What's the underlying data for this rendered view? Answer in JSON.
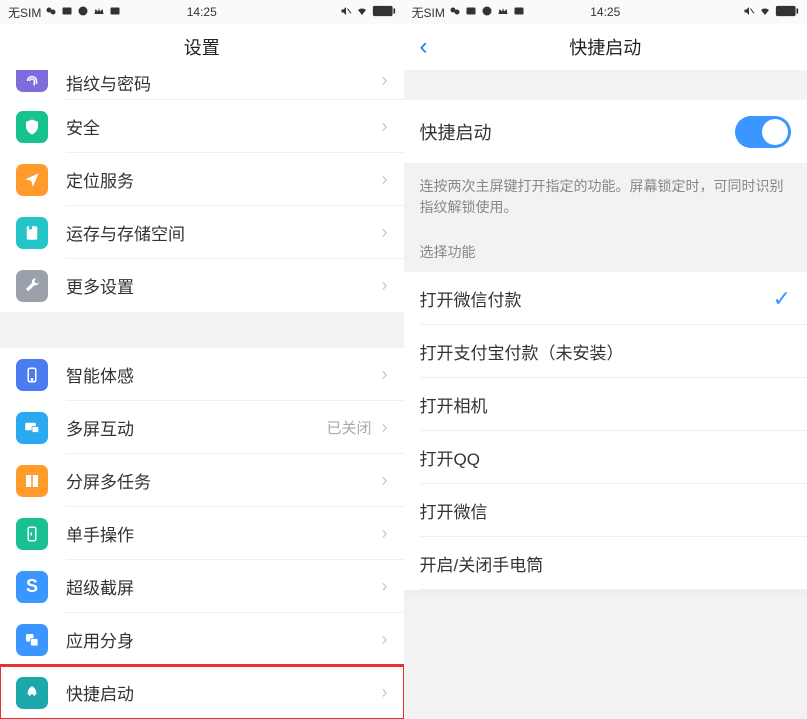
{
  "status": {
    "nosim": "无SIM",
    "time": "14:25"
  },
  "left": {
    "title": "设置",
    "rows": [
      {
        "id": "fingerprint",
        "label": "指纹与密码",
        "iconColor": "#7f6bdc",
        "partial": true
      },
      {
        "id": "security",
        "label": "安全",
        "iconColor": "#18c18f"
      },
      {
        "id": "location",
        "label": "定位服务",
        "iconColor": "#ff9a2c"
      },
      {
        "id": "storage",
        "label": "运存与存储空间",
        "iconColor": "#23c5c9"
      },
      {
        "id": "more",
        "label": "更多设置",
        "iconColor": "#9aa1aa"
      },
      {
        "id": "gesture",
        "label": "智能体感",
        "iconColor": "#4c7af1"
      },
      {
        "id": "multiscreen",
        "label": "多屏互动",
        "iconColor": "#2aa8f0",
        "value": "已关闭"
      },
      {
        "id": "splitscreen",
        "label": "分屏多任务",
        "iconColor": "#ff9a2c"
      },
      {
        "id": "onehand",
        "label": "单手操作",
        "iconColor": "#18c18f"
      },
      {
        "id": "screenshot",
        "label": "超级截屏",
        "iconColor": "#3c96ff"
      },
      {
        "id": "appclone",
        "label": "应用分身",
        "iconColor": "#3c96ff"
      },
      {
        "id": "quicklaunch",
        "label": "快捷启动",
        "iconColor": "#1aa8a8",
        "highlight": true
      }
    ]
  },
  "right": {
    "title": "快捷启动",
    "toggle": {
      "label": "快捷启动",
      "on": true
    },
    "hint": "连按两次主屏键打开指定的功能。屏幕锁定时，可同时识别指纹解锁使用。",
    "section": "选择功能",
    "options": [
      {
        "label": "打开微信付款",
        "checked": true
      },
      {
        "label": "打开支付宝付款（未安装）"
      },
      {
        "label": "打开相机"
      },
      {
        "label": "打开QQ"
      },
      {
        "label": "打开微信"
      },
      {
        "label": "开启/关闭手电筒"
      }
    ]
  }
}
